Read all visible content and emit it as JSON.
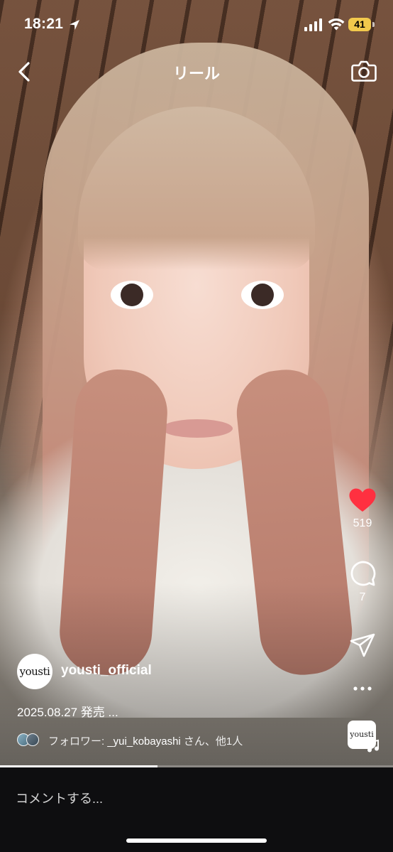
{
  "status_bar": {
    "time": "18:21",
    "battery": "41",
    "battery_color": "#f2c94c"
  },
  "header": {
    "title": "リール",
    "back_icon": "chevron-left-icon",
    "camera_icon": "camera-icon"
  },
  "actions": {
    "like_count": "519",
    "like_color": "#ff3040",
    "comment_count": "7",
    "share_icon": "send-icon",
    "more_icon": "more-horizontal-icon"
  },
  "post": {
    "avatar_text": "yousti",
    "username": "yousti_official",
    "caption": "2025.08.27 発売 ...",
    "followers_prefix": "フォロワー: ",
    "followers_name": "_yui_kobayashi",
    "followers_suffix": " さん、他1人"
  },
  "audio": {
    "thumb_text": "yousti"
  },
  "progress": {
    "fraction": 0.4
  },
  "comment_bar": {
    "placeholder": "コメントする..."
  }
}
